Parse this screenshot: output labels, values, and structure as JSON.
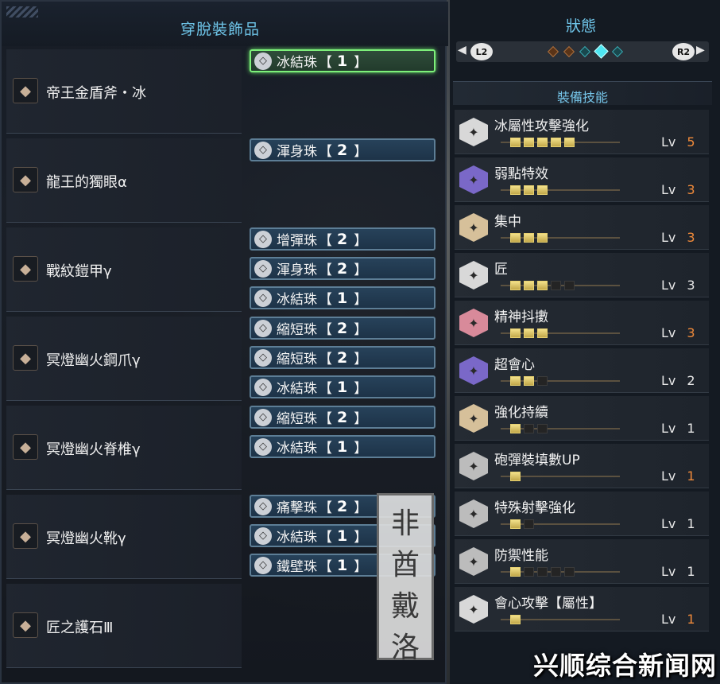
{
  "left": {
    "title": "穿脫裝飾品",
    "equipment": [
      {
        "name": "帝王金盾斧・冰",
        "icon": "weapon-chargeblade-icon",
        "decorations": [
          {
            "name": "冰結珠",
            "lvl": "1",
            "icon": "decoration-gem-icon",
            "selected": true
          }
        ]
      },
      {
        "name": "龍王的獨眼α",
        "icon": "helmet-icon",
        "decorations": [
          {
            "name": "渾身珠",
            "lvl": "2",
            "icon": "decoration-gem-icon"
          }
        ]
      },
      {
        "name": "戰紋鎧甲γ",
        "icon": "chest-armor-icon",
        "decorations": [
          {
            "name": "增彈珠",
            "lvl": "2",
            "icon": "decoration-gem-icon"
          },
          {
            "name": "渾身珠",
            "lvl": "2",
            "icon": "decoration-gem-icon"
          },
          {
            "name": "冰結珠",
            "lvl": "1",
            "icon": "decoration-gem-icon"
          }
        ]
      },
      {
        "name": "冥燈幽火鋼爪γ",
        "icon": "arm-armor-icon",
        "decorations": [
          {
            "name": "縮短珠",
            "lvl": "2",
            "icon": "decoration-gem-icon"
          },
          {
            "name": "縮短珠",
            "lvl": "2",
            "icon": "decoration-gem-icon"
          },
          {
            "name": "冰結珠",
            "lvl": "1",
            "icon": "decoration-gem-icon"
          }
        ]
      },
      {
        "name": "冥燈幽火脊椎γ",
        "icon": "waist-armor-icon",
        "decorations": [
          {
            "name": "縮短珠",
            "lvl": "2",
            "icon": "decoration-gem-icon"
          },
          {
            "name": "冰結珠",
            "lvl": "1",
            "icon": "decoration-gem-icon"
          }
        ]
      },
      {
        "name": "冥燈幽火靴γ",
        "icon": "leg-armor-icon",
        "decorations": [
          {
            "name": "痛擊珠",
            "lvl": "2",
            "icon": "decoration-gem-icon"
          },
          {
            "name": "冰結珠",
            "lvl": "1",
            "icon": "decoration-gem-icon"
          },
          {
            "name": "鐵壁珠",
            "lvl": "1",
            "icon": "decoration-gem-icon"
          }
        ]
      },
      {
        "name": "匠之護石Ⅲ",
        "icon": "charm-icon",
        "decorations": []
      }
    ],
    "bracket_open": "【",
    "bracket_close": "】"
  },
  "stamp": {
    "chars": [
      "非",
      "酋",
      "戴",
      "洛"
    ]
  },
  "right": {
    "title": "狀態",
    "nav_left": "L2",
    "nav_right": "R2",
    "section": "裝備技能",
    "lv_label": "Lv",
    "skills": [
      {
        "name": "冰屬性攻擊強化",
        "lv": "5",
        "slots": 5,
        "filled": 5,
        "maxed": true,
        "color": "#d8d8d8"
      },
      {
        "name": "弱點特效",
        "lv": "3",
        "slots": 3,
        "filled": 3,
        "maxed": true,
        "color": "#7a68c8"
      },
      {
        "name": "集中",
        "lv": "3",
        "slots": 3,
        "filled": 3,
        "maxed": true,
        "color": "#d6c09a"
      },
      {
        "name": "匠",
        "lv": "3",
        "slots": 5,
        "filled": 3,
        "maxed": false,
        "color": "#d8d8d8"
      },
      {
        "name": "精神抖擻",
        "lv": "3",
        "slots": 3,
        "filled": 3,
        "maxed": true,
        "color": "#d88a9a"
      },
      {
        "name": "超會心",
        "lv": "2",
        "slots": 3,
        "filled": 2,
        "maxed": false,
        "color": "#7a68c8"
      },
      {
        "name": "強化持續",
        "lv": "1",
        "slots": 3,
        "filled": 1,
        "maxed": false,
        "color": "#d6c09a"
      },
      {
        "name": "砲彈裝填數UP",
        "lv": "1",
        "slots": 1,
        "filled": 1,
        "maxed": true,
        "color": "#bcbcbc"
      },
      {
        "name": "特殊射擊強化",
        "lv": "1",
        "slots": 2,
        "filled": 1,
        "maxed": false,
        "color": "#bcbcbc"
      },
      {
        "name": "防禦性能",
        "lv": "1",
        "slots": 5,
        "filled": 1,
        "maxed": false,
        "color": "#bcbcbc"
      },
      {
        "name": "會心攻擊【屬性】",
        "lv": "1",
        "slots": 1,
        "filled": 1,
        "maxed": true,
        "color": "#d8d8d8"
      }
    ]
  },
  "watermark": "兴顺综合新闻网"
}
